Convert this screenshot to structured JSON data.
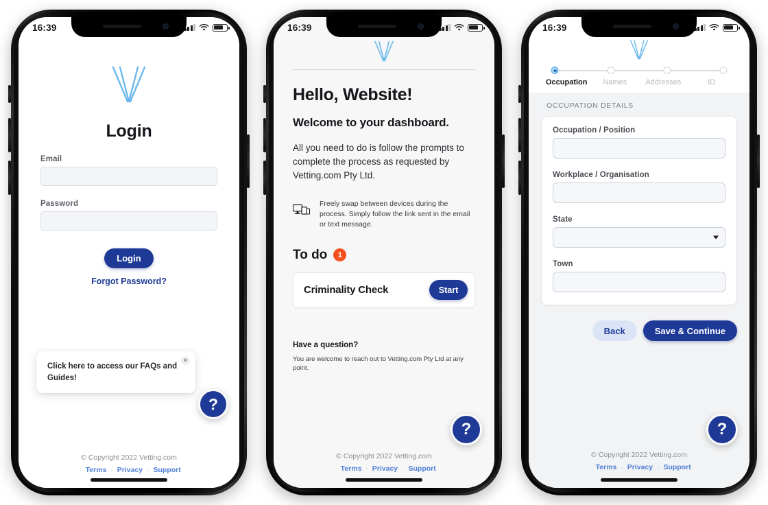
{
  "brand": {
    "logo_name": "vetting-v-logo",
    "logo_color": "#6bb8ec",
    "primary_color": "#1e3a96",
    "accent_color": "#f4511e"
  },
  "status_bar": {
    "time": "16:39",
    "signal_icon": "cellular-signal-icon",
    "wifi_icon": "wifi-icon",
    "battery_icon": "battery-icon"
  },
  "footer": {
    "copyright": "© Copyright 2022 Vetting.com",
    "links": [
      {
        "label": "Terms"
      },
      {
        "label": "Privacy"
      },
      {
        "label": "Support"
      }
    ],
    "separator": "·"
  },
  "help_fab": {
    "label": "?",
    "icon": "question-mark-icon"
  },
  "screen_login": {
    "title": "Login",
    "fields": [
      {
        "label": "Email",
        "value": "",
        "placeholder": ""
      },
      {
        "label": "Password",
        "value": "",
        "placeholder": ""
      }
    ],
    "login_button": "Login",
    "forgot_password": "Forgot Password?",
    "tooltip": {
      "text": "Click here to access our FAQs and Guides!",
      "close_label": "✕"
    }
  },
  "screen_dashboard": {
    "greeting": "Hello, Website!",
    "subheading": "Welcome to your dashboard.",
    "intro": "All you need to do is follow the prompts to complete the process as requested by Vetting.com Pty Ltd.",
    "device_swap": {
      "icon": "multi-device-icon",
      "text": "Freely swap between devices during the process. Simply follow the link sent in the email or text message."
    },
    "todo": {
      "heading": "To do",
      "count": "1",
      "tasks": [
        {
          "name": "Criminality Check",
          "action": "Start"
        }
      ]
    },
    "question": {
      "heading": "Have a question?",
      "text": "You are welcome to reach out to Vetting.com Pty Ltd at any point."
    }
  },
  "screen_occupation": {
    "steps": [
      {
        "label": "Occupation",
        "active": true
      },
      {
        "label": "Names",
        "active": false
      },
      {
        "label": "Addresses",
        "active": false
      },
      {
        "label": "ID",
        "active": false
      }
    ],
    "section_title": "OCCUPATION DETAILS",
    "fields": [
      {
        "label": "Occupation / Position",
        "value": "",
        "type": "text"
      },
      {
        "label": "Workplace / Organisation",
        "value": "",
        "type": "text"
      },
      {
        "label": "State",
        "value": "",
        "type": "select"
      },
      {
        "label": "Town",
        "value": "",
        "type": "text"
      }
    ],
    "back_button": "Back",
    "save_button": "Save & Continue"
  }
}
